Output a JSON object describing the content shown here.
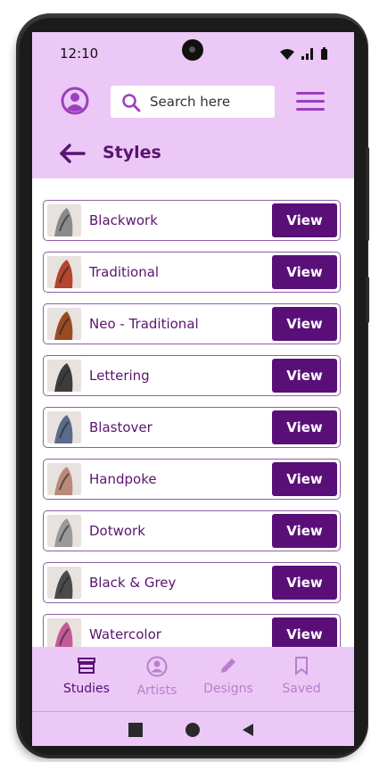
{
  "status_bar": {
    "time": "12:10"
  },
  "header": {
    "search_placeholder": "Search here",
    "title": "Styles"
  },
  "styles": [
    {
      "name": "Blackwork",
      "action": "View",
      "thumb_color": "#8a8a8a"
    },
    {
      "name": "Traditional",
      "action": "View",
      "thumb_color": "#b5452e"
    },
    {
      "name": "Neo - Traditional",
      "action": "View",
      "thumb_color": "#9a4a22"
    },
    {
      "name": "Lettering",
      "action": "View",
      "thumb_color": "#3c3c3c"
    },
    {
      "name": "Blastover",
      "action": "View",
      "thumb_color": "#5a6b8a"
    },
    {
      "name": "Handpoke",
      "action": "View",
      "thumb_color": "#b88a7a"
    },
    {
      "name": "Dotwork",
      "action": "View",
      "thumb_color": "#9a9a9a"
    },
    {
      "name": "Black & Grey",
      "action": "View",
      "thumb_color": "#4a4a4a"
    },
    {
      "name": "Watercolor",
      "action": "View",
      "thumb_color": "#c25a9a"
    }
  ],
  "bottom_nav": {
    "items": [
      {
        "label": "Studies",
        "active": true,
        "icon": "store-icon"
      },
      {
        "label": "Artists",
        "active": false,
        "icon": "user-circle-icon"
      },
      {
        "label": "Designs",
        "active": false,
        "icon": "pencil-icon"
      },
      {
        "label": "Saved",
        "active": false,
        "icon": "bookmark-icon"
      }
    ]
  },
  "colors": {
    "header_bg": "#ecc8f6",
    "accent": "#5a0f78",
    "icon_purple": "#9b3fbf",
    "inactive_nav": "#b77fcb"
  }
}
